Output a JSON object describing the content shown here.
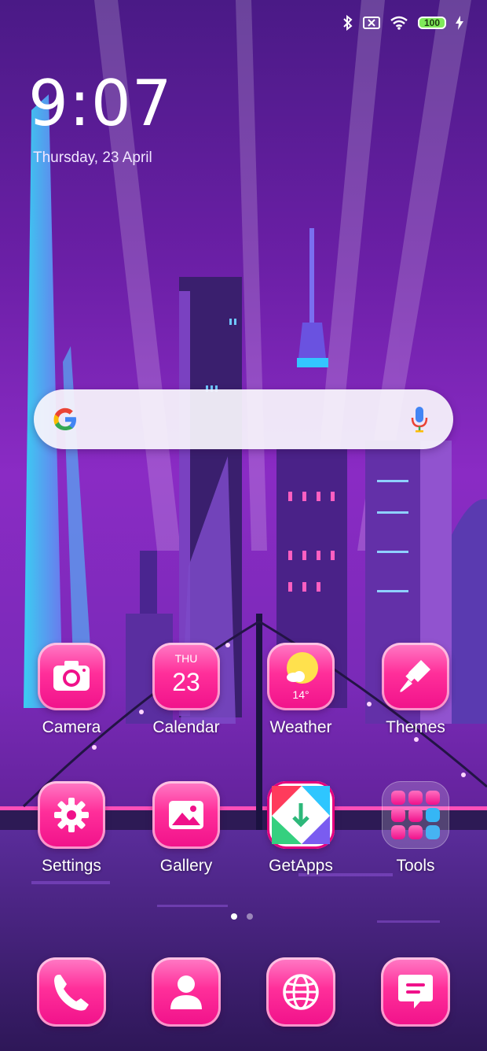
{
  "status_bar": {
    "icons": [
      "bluetooth-icon",
      "sim-off-icon",
      "wifi-icon",
      "battery-icon",
      "charging-icon"
    ],
    "battery_level": "100"
  },
  "lock_clock": {
    "time": "9:07",
    "date": "Thursday, 23 April"
  },
  "search": {
    "icons": [
      "google-logo-icon",
      "microphone-icon"
    ]
  },
  "apps_row1": [
    {
      "label": "Camera",
      "icon": "camera-icon"
    },
    {
      "label": "Calendar",
      "icon": "calendar-icon",
      "day": "THU",
      "date": "23"
    },
    {
      "label": "Weather",
      "icon": "weather-sun-icon",
      "temp": "14°"
    },
    {
      "label": "Themes",
      "icon": "paintbrush-icon"
    }
  ],
  "apps_row2": [
    {
      "label": "Settings",
      "icon": "gear-icon"
    },
    {
      "label": "Gallery",
      "icon": "image-icon"
    },
    {
      "label": "GetApps",
      "icon": "getapps-icon"
    },
    {
      "label": "Tools",
      "icon": "folder-icon"
    }
  ],
  "page_indicator": {
    "pages": 2,
    "current": 1
  },
  "dock": [
    {
      "icon": "phone-icon"
    },
    {
      "icon": "contacts-icon"
    },
    {
      "icon": "browser-globe-icon"
    },
    {
      "icon": "messages-icon"
    }
  ],
  "colors": {
    "accent_pink": "#f0118a",
    "tile_light_pink": "#ff7cc6",
    "wallpaper_purple": "#8a2bc4",
    "battery_green": "#7fe85a"
  }
}
